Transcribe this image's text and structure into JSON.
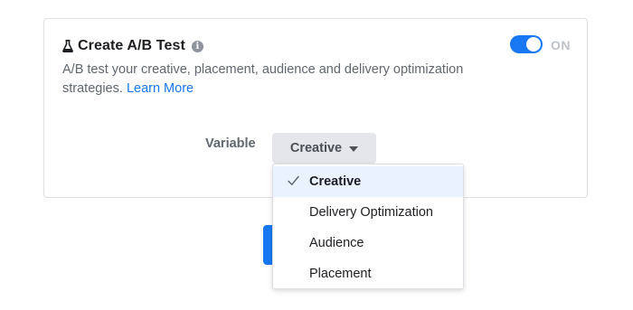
{
  "card": {
    "title": "Create A/B Test",
    "description": "A/B test your creative, placement, audience and delivery optimization strategies.",
    "learn_more": "Learn More",
    "toggle_label": "ON",
    "toggle_state": "on"
  },
  "variable": {
    "label": "Variable",
    "selected": "Creative"
  },
  "dropdown": {
    "items": [
      {
        "label": "Creative",
        "selected": true
      },
      {
        "label": "Delivery Optimization",
        "selected": false
      },
      {
        "label": "Audience",
        "selected": false
      },
      {
        "label": "Placement",
        "selected": false
      }
    ]
  },
  "colors": {
    "accent": "#1877f2",
    "selected_bg": "#ebf2ff",
    "muted_text": "#606770"
  },
  "icons": {
    "title_icon": "flask-icon",
    "info": "info-icon",
    "caret": "caret-down-icon",
    "check": "check-icon"
  }
}
